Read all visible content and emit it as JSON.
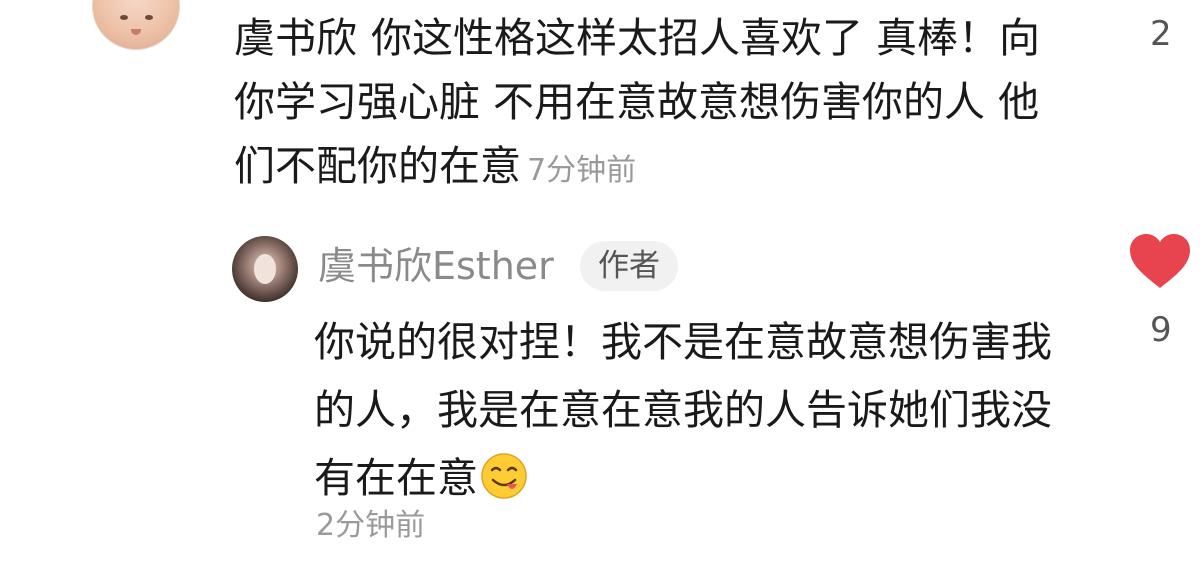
{
  "comment": {
    "username": "虞书欣",
    "text": "你这性格这样太招人喜欢了 真棒！向你学习强心脏 不用在意故意想伤害你的人 他们不配你的在意",
    "time": "7分钟前",
    "like_count": "2"
  },
  "reply": {
    "author": "虞书欣Esther",
    "badge": "作者",
    "text": "你说的很对捏！我不是在意故意想伤害我的人，我是在意在意我的人告诉她们我没有在在意",
    "emoji": "smiling-face-tongue-icon",
    "time": "2分钟前",
    "like_count": "9",
    "liked": true,
    "like_color": "#e8444e"
  }
}
